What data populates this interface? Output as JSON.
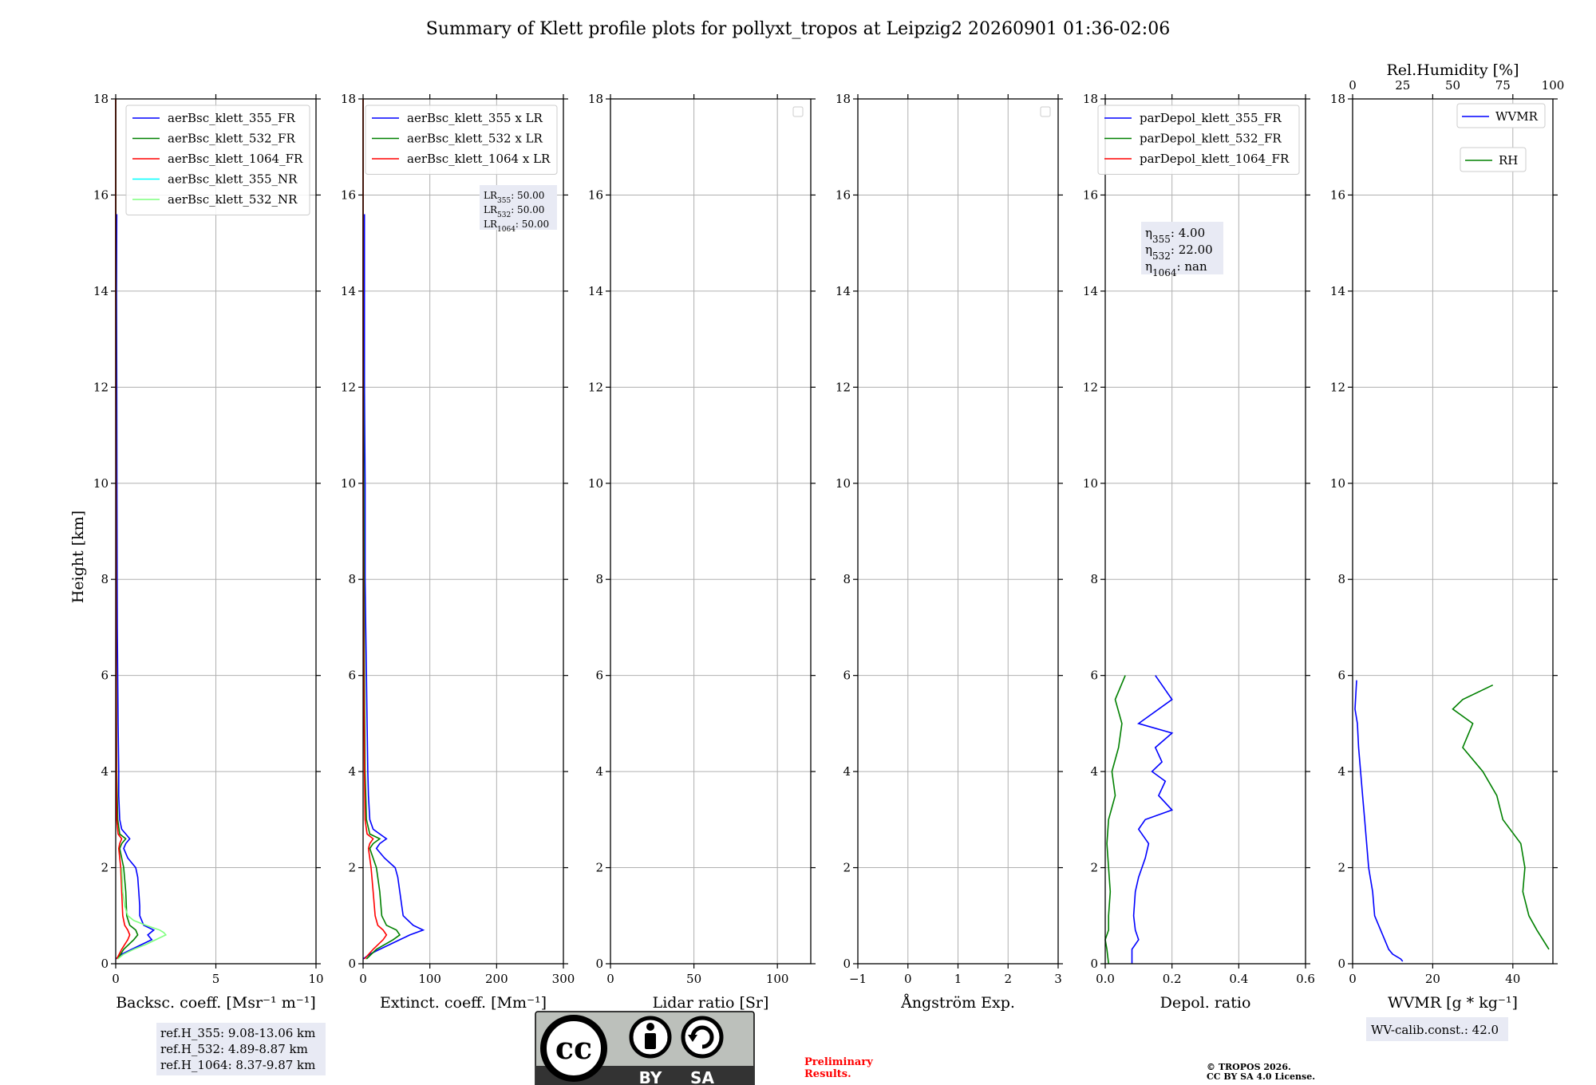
{
  "title": "Summary of Klett profile plots for pollyxt_tropos at Leipzig2 20260901 01:36-02:06",
  "ylabel": "Height [km]",
  "y_ticks": [
    "0",
    "2",
    "4",
    "6",
    "8",
    "10",
    "12",
    "14",
    "16",
    "18"
  ],
  "chart_data": [
    {
      "type": "line",
      "id": "backscatter",
      "xlabel": "Backsc. coeff. [Msr⁻¹ m⁻¹]",
      "xlim": [
        0,
        10
      ],
      "ylim": [
        0,
        18
      ],
      "x_ticks": [
        0,
        5,
        10
      ],
      "x_tick_labels": [
        "0",
        "5",
        "10"
      ],
      "legend_position": "top-right",
      "series": [
        {
          "name": "aerBsc_klett_355_FR",
          "color": "#0000ff",
          "heights": [
            0.1,
            0.2,
            0.3,
            0.4,
            0.5,
            0.6,
            0.7,
            0.8,
            1.0,
            1.2,
            1.5,
            1.8,
            2.0,
            2.2,
            2.4,
            2.5,
            2.6,
            2.7,
            2.8,
            3.0,
            3.5,
            4.0,
            5.0,
            6.0,
            7.0,
            8.0,
            10.0,
            12.0,
            14.0,
            15.6
          ],
          "values": [
            -0.2,
            0.3,
            0.8,
            1.3,
            1.8,
            1.6,
            1.9,
            1.4,
            1.2,
            1.2,
            1.15,
            1.1,
            1.0,
            0.6,
            0.4,
            0.5,
            0.7,
            0.5,
            0.3,
            0.2,
            0.15,
            0.15,
            0.12,
            0.1,
            0.08,
            0.07,
            0.06,
            0.05,
            0.04,
            0.05
          ]
        },
        {
          "name": "aerBsc_klett_532_FR",
          "color": "#008000",
          "heights": [
            0.1,
            0.3,
            0.5,
            0.6,
            0.7,
            0.8,
            1.0,
            1.5,
            2.0,
            2.4,
            2.5,
            2.6,
            2.7,
            3.0,
            4.0,
            6.0,
            10.0,
            14.0,
            18.0
          ],
          "values": [
            0.1,
            0.4,
            0.9,
            1.1,
            1.0,
            0.7,
            0.55,
            0.5,
            0.4,
            0.2,
            0.3,
            0.5,
            0.2,
            0.1,
            0.05,
            0.03,
            0.02,
            0.01,
            0.0
          ]
        },
        {
          "name": "aerBsc_klett_1064_FR",
          "color": "#ff0000",
          "heights": [
            0.1,
            0.3,
            0.5,
            0.6,
            0.7,
            0.8,
            1.0,
            1.5,
            2.0,
            2.4,
            2.5,
            2.6,
            2.7,
            3.0,
            4.0,
            6.0,
            10.0,
            14.0,
            18.0
          ],
          "values": [
            0.05,
            0.3,
            0.6,
            0.7,
            0.6,
            0.45,
            0.35,
            0.3,
            0.25,
            0.15,
            0.2,
            0.3,
            0.12,
            0.05,
            0.03,
            0.02,
            0.01,
            0.0,
            0.0
          ]
        },
        {
          "name": "aerBsc_klett_355_NR",
          "color": "#00ffff",
          "heights": [],
          "values": []
        },
        {
          "name": "aerBsc_klett_532_NR",
          "color": "#7fff7f",
          "heights": [
            0.1,
            0.2,
            0.3,
            0.4,
            0.5,
            0.6,
            0.65,
            0.7,
            0.8,
            0.9,
            1.0,
            1.2,
            1.5,
            2.0
          ],
          "values": [
            0.1,
            0.4,
            0.9,
            1.5,
            2.0,
            2.5,
            2.4,
            2.2,
            1.5,
            0.9,
            0.6,
            0.45,
            0.35,
            0.3
          ]
        }
      ],
      "info_box": [
        "ref.H_355: 9.08-13.06 km",
        "ref.H_532: 4.89-8.87 km",
        "ref.H_1064: 8.37-9.87 km"
      ]
    },
    {
      "type": "line",
      "id": "extinction",
      "xlabel": "Extinct. coeff. [Mm⁻¹]",
      "xlim": [
        0,
        300
      ],
      "ylim": [
        0,
        18
      ],
      "x_ticks": [
        0,
        100,
        200,
        300
      ],
      "x_tick_labels": [
        "0",
        "100",
        "200",
        "300"
      ],
      "legend_position": "top-right",
      "series": [
        {
          "name": "aerBsc_klett_355 x LR",
          "color": "#0000ff",
          "heights": [
            0.1,
            0.2,
            0.3,
            0.4,
            0.5,
            0.6,
            0.7,
            0.8,
            1.0,
            1.2,
            1.5,
            1.8,
            2.0,
            2.2,
            2.4,
            2.5,
            2.6,
            2.7,
            2.8,
            3.0,
            3.5,
            4.0,
            5.0,
            6.0,
            7.0,
            8.0,
            10.0,
            12.0,
            14.0,
            15.6
          ],
          "values": [
            -5,
            10,
            25,
            40,
            55,
            70,
            90,
            75,
            60,
            58,
            55,
            52,
            48,
            32,
            20,
            25,
            35,
            25,
            15,
            10,
            8,
            7,
            6,
            5,
            4,
            3,
            3,
            2,
            2,
            2
          ]
        },
        {
          "name": "aerBsc_klett_532 x LR",
          "color": "#008000",
          "heights": [
            0.1,
            0.3,
            0.5,
            0.6,
            0.7,
            0.8,
            1.0,
            1.5,
            2.0,
            2.4,
            2.5,
            2.6,
            2.7,
            3.0,
            4.0,
            6.0,
            10.0,
            14.0,
            18.0
          ],
          "values": [
            5,
            20,
            45,
            55,
            50,
            35,
            28,
            25,
            20,
            10,
            15,
            25,
            10,
            5,
            3,
            2,
            1,
            0,
            0
          ]
        },
        {
          "name": "aerBsc_klett_1064 x LR",
          "color": "#ff0000",
          "heights": [
            0.1,
            0.3,
            0.5,
            0.6,
            0.7,
            0.8,
            1.0,
            1.5,
            2.0,
            2.4,
            2.5,
            2.6,
            2.7,
            3.0,
            4.0,
            6.0,
            10.0,
            14.0,
            18.0
          ],
          "values": [
            2,
            15,
            30,
            35,
            30,
            22,
            18,
            15,
            12,
            8,
            10,
            15,
            6,
            3,
            2,
            1,
            0,
            0,
            0
          ]
        }
      ],
      "lr_box": [
        {
          "sub": "355",
          "value": ": 50.00"
        },
        {
          "sub": "532",
          "value": ": 50.00"
        },
        {
          "sub": "1064",
          "value": ": 50.00"
        }
      ]
    },
    {
      "type": "line",
      "id": "lidar-ratio",
      "xlabel": "Lidar ratio [Sr]",
      "xlim": [
        0,
        120
      ],
      "ylim": [
        0,
        18
      ],
      "x_ticks": [
        0,
        50,
        100
      ],
      "x_tick_labels": [
        "0",
        "50",
        "100"
      ],
      "series": []
    },
    {
      "type": "line",
      "id": "angstrom",
      "xlabel": "Ångström Exp.",
      "xlim": [
        -1,
        3
      ],
      "ylim": [
        0,
        18
      ],
      "x_ticks": [
        -1,
        0,
        1,
        2,
        3
      ],
      "x_tick_labels": [
        "−1",
        "0",
        "1",
        "2",
        "3"
      ],
      "series": []
    },
    {
      "type": "line",
      "id": "depol",
      "xlabel": "Depol. ratio",
      "xlim": [
        0,
        0.6
      ],
      "ylim": [
        0,
        18
      ],
      "x_ticks": [
        0,
        0.2,
        0.4,
        0.6
      ],
      "x_tick_labels": [
        "0.0",
        "0.2",
        "0.4",
        "0.6"
      ],
      "legend_position": "top-right",
      "series": [
        {
          "name": "parDepol_klett_355_FR",
          "color": "#0000ff",
          "heights": [
            0.0,
            0.3,
            0.5,
            0.7,
            1.0,
            1.5,
            1.8,
            2.0,
            2.2,
            2.5,
            2.8,
            3.0,
            3.2,
            3.5,
            3.8,
            4.0,
            4.2,
            4.5,
            4.8,
            5.0,
            5.5,
            6.0
          ],
          "values": [
            0.08,
            0.08,
            0.1,
            0.09,
            0.085,
            0.09,
            0.1,
            0.11,
            0.12,
            0.13,
            0.1,
            0.12,
            0.2,
            0.16,
            0.18,
            0.14,
            0.17,
            0.15,
            0.2,
            0.1,
            0.2,
            0.15
          ]
        },
        {
          "name": "parDepol_klett_532_FR",
          "color": "#008000",
          "heights": [
            0.0,
            0.3,
            0.5,
            0.7,
            1.0,
            1.5,
            2.0,
            2.5,
            3.0,
            3.5,
            4.0,
            4.5,
            5.0,
            5.5,
            6.0
          ],
          "values": [
            0.01,
            0.005,
            0.0,
            0.01,
            0.01,
            0.015,
            0.01,
            0.005,
            0.01,
            0.03,
            0.02,
            0.04,
            0.05,
            0.03,
            0.06
          ]
        },
        {
          "name": "parDepol_klett_1064_FR",
          "color": "#ff0000",
          "heights": [],
          "values": []
        }
      ],
      "eta_box": [
        {
          "sub": "355",
          "value": ": 4.00"
        },
        {
          "sub": "532",
          "value": ": 22.00"
        },
        {
          "sub": "1064",
          "value": ": nan"
        }
      ]
    },
    {
      "type": "line",
      "id": "wvmr",
      "xlabel": "WVMR [g * kg⁻¹]",
      "xlim": [
        0,
        50
      ],
      "ylim": [
        0,
        18
      ],
      "x_ticks": [
        0,
        20,
        40
      ],
      "x_tick_labels": [
        "0",
        "20",
        "40"
      ],
      "top_axis": {
        "label": "Rel.Humidity [%]",
        "lim": [
          0,
          100
        ],
        "ticks": [
          0,
          25,
          50,
          75,
          100
        ],
        "tick_labels": [
          "0",
          "25",
          "50",
          "75",
          "100"
        ]
      },
      "series": [
        {
          "name": "WVMR",
          "color": "#0000ff",
          "axis": "bottom",
          "heights": [
            0.05,
            0.1,
            0.2,
            0.3,
            0.5,
            0.8,
            1.0,
            1.5,
            2.0,
            2.5,
            3.0,
            3.5,
            4.0,
            4.5,
            5.0,
            5.3,
            5.6,
            5.9
          ],
          "values": [
            12.5,
            12,
            10,
            9,
            8,
            6.5,
            5.5,
            5,
            4,
            3.5,
            3,
            2.5,
            2,
            1.5,
            1.2,
            0.6,
            0.8,
            1
          ]
        },
        {
          "name": "RH",
          "color": "#008000",
          "axis": "top",
          "heights": [
            0.3,
            0.5,
            0.7,
            1.0,
            1.5,
            2.0,
            2.5,
            3.0,
            3.5,
            4.0,
            4.5,
            5.0,
            5.3,
            5.5,
            5.8
          ],
          "values": [
            98,
            95,
            92,
            88,
            85,
            86,
            84,
            75,
            72,
            65,
            55,
            60,
            50,
            55,
            70
          ]
        }
      ],
      "info_box": [
        "WV-calib.const.: 42.0"
      ]
    }
  ],
  "license": {
    "by": "BY",
    "sa": "SA",
    "cc": "cc"
  },
  "preliminary": [
    "Preliminary",
    "Results."
  ],
  "copyright": [
    "© TROPOS 2026.",
    "CC BY SA 4.0 License."
  ],
  "colors": {
    "axes": "#000000",
    "grid": "#b0b0b0",
    "preliminary": "#ff0000",
    "info_bg": "#e8eaf4",
    "license_bg": "#bcc0bb",
    "license_band": "#333333"
  }
}
